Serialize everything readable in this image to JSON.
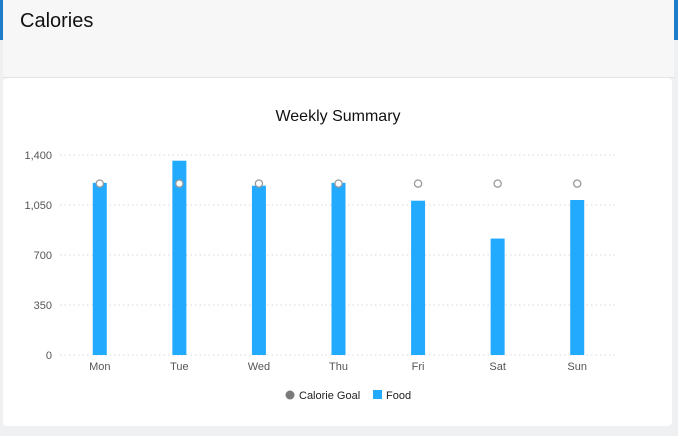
{
  "page": {
    "title": "Calories"
  },
  "colors": {
    "accent": "#1e7dc8",
    "food": "#22aaff",
    "goal": "#ffffff",
    "goal_stroke": "#9a9a9a",
    "legend_goal": "#7a7a7a",
    "grid": "#d8d8d8",
    "axis_text": "#555555"
  },
  "chart_data": {
    "type": "bar",
    "title": "Weekly Summary",
    "xlabel": "",
    "ylabel": "",
    "categories": [
      "Mon",
      "Tue",
      "Wed",
      "Thu",
      "Fri",
      "Sat",
      "Sun"
    ],
    "ylim": [
      0,
      1400
    ],
    "yticks": [
      {
        "value": 0,
        "label": "0"
      },
      {
        "value": 350,
        "label": "350"
      },
      {
        "value": 700,
        "label": "700"
      },
      {
        "value": 1050,
        "label": "1,050"
      },
      {
        "value": 1400,
        "label": "1,400"
      }
    ],
    "grid": true,
    "legend_position": "bottom",
    "series": [
      {
        "name": "Food",
        "type": "bar",
        "values": [
          1205,
          1360,
          1185,
          1205,
          1080,
          815,
          1085
        ]
      },
      {
        "name": "Calorie Goal",
        "type": "point",
        "values": [
          1200,
          1200,
          1200,
          1200,
          1200,
          1200,
          1200
        ]
      }
    ]
  }
}
